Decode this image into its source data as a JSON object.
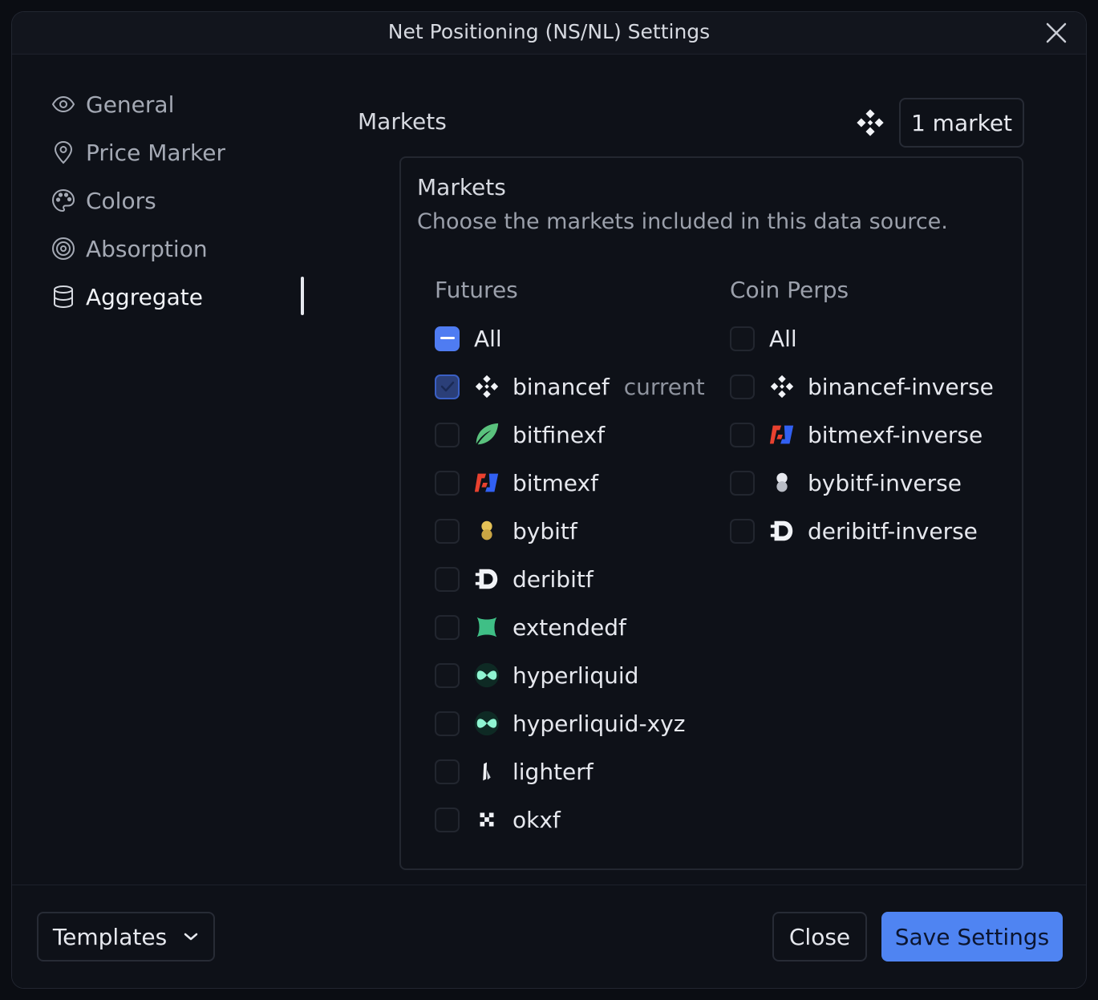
{
  "dialog": {
    "title": "Net Positioning (NS/NL) Settings"
  },
  "sidebar": {
    "items": [
      {
        "label": "General",
        "icon": "eye-icon"
      },
      {
        "label": "Price Marker",
        "icon": "map-pin-icon"
      },
      {
        "label": "Colors",
        "icon": "palette-icon"
      },
      {
        "label": "Absorption",
        "icon": "target-icon"
      },
      {
        "label": "Aggregate",
        "icon": "database-icon",
        "active": true
      }
    ]
  },
  "markets": {
    "label": "Markets",
    "selected_count_label": "1 market",
    "panel_title": "Markets",
    "panel_description": "Choose the markets included in this data source.",
    "futures": {
      "heading": "Futures",
      "all_label": "All",
      "all_state": "indeterminate",
      "items": [
        {
          "label": "binancef",
          "tag": "current",
          "checked": true,
          "logo": "binance-logo"
        },
        {
          "label": "bitfinexf",
          "checked": false,
          "logo": "bitfinex-logo"
        },
        {
          "label": "bitmexf",
          "checked": false,
          "logo": "bitmex-logo"
        },
        {
          "label": "bybitf",
          "checked": false,
          "logo": "bybit-logo"
        },
        {
          "label": "deribitf",
          "checked": false,
          "logo": "deribit-logo"
        },
        {
          "label": "extendedf",
          "checked": false,
          "logo": "extended-logo"
        },
        {
          "label": "hyperliquid",
          "checked": false,
          "logo": "hyperliquid-logo"
        },
        {
          "label": "hyperliquid-xyz",
          "checked": false,
          "logo": "hyperliquid-logo"
        },
        {
          "label": "lighterf",
          "checked": false,
          "logo": "lighter-logo"
        },
        {
          "label": "okxf",
          "checked": false,
          "logo": "okx-logo"
        }
      ]
    },
    "coin_perps": {
      "heading": "Coin Perps",
      "all_label": "All",
      "all_state": "unchecked",
      "items": [
        {
          "label": "binancef-inverse",
          "checked": false,
          "logo": "binance-logo"
        },
        {
          "label": "bitmexf-inverse",
          "checked": false,
          "logo": "bitmex-logo"
        },
        {
          "label": "bybitf-inverse",
          "checked": false,
          "logo": "bybit-logo"
        },
        {
          "label": "deribitf-inverse",
          "checked": false,
          "logo": "deribit-logo"
        }
      ]
    }
  },
  "footer": {
    "templates_label": "Templates",
    "close_label": "Close",
    "save_label": "Save Settings"
  },
  "colors": {
    "accent": "#4f84f2",
    "background": "#0e1118",
    "text": "#e6e8ee",
    "muted_text": "#9ba0ab"
  }
}
